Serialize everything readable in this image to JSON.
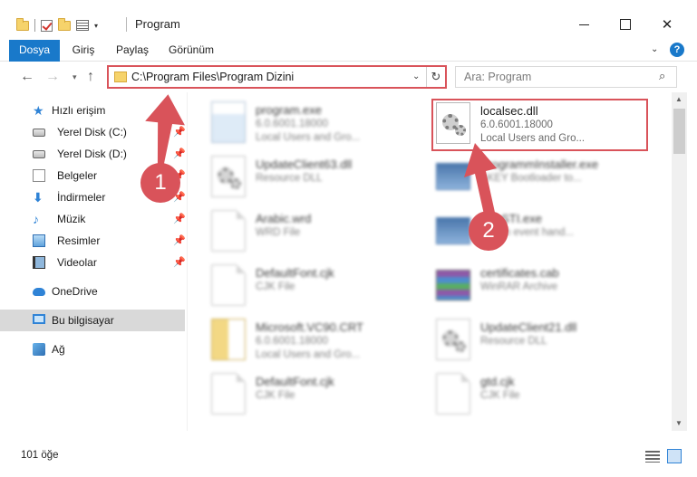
{
  "window": {
    "title": "Program"
  },
  "ribbon": {
    "tabs": [
      "Dosya",
      "Giriş",
      "Paylaş",
      "Görünüm"
    ],
    "help": "?"
  },
  "address": {
    "path": "C:\\Program Files\\Program Dizini"
  },
  "search": {
    "placeholder": "Ara: Program"
  },
  "sidebar": {
    "items": [
      {
        "label": "Hızlı erişim",
        "icon": "star-icon"
      },
      {
        "label": "Yerel Disk (C:)",
        "icon": "drive-icon",
        "pinned": true
      },
      {
        "label": "Yerel Disk (D:)",
        "icon": "drive-icon",
        "pinned": true
      },
      {
        "label": "Belgeler",
        "icon": "documents-icon",
        "pinned": true
      },
      {
        "label": "İndirmeler",
        "icon": "downloads-icon",
        "pinned": true
      },
      {
        "label": "Müzik",
        "icon": "music-icon",
        "pinned": true
      },
      {
        "label": "Resimler",
        "icon": "pictures-icon",
        "pinned": true
      },
      {
        "label": "Videolar",
        "icon": "videos-icon",
        "pinned": true
      },
      {
        "label": "OneDrive",
        "icon": "cloud-icon"
      },
      {
        "label": "Bu bilgisayar",
        "icon": "computer-icon",
        "selected": true
      },
      {
        "label": "Ağ",
        "icon": "network-icon"
      }
    ]
  },
  "files": [
    {
      "name": "program.exe",
      "line2": "6.0.6001.18000",
      "line3": "Local Users and Gro...",
      "blurred": true
    },
    {
      "name": "localsec.dll",
      "line2": "6.0.6001.18000",
      "line3": "Local Users and Gro...",
      "blurred": false,
      "highlighted": true
    },
    {
      "name": "UpdateClient63.dll",
      "line2": "Resource DLL",
      "line3": "",
      "blurred": true
    },
    {
      "name": "ProgrammInstaller.exe",
      "line2": "AKEY Bootloader to...",
      "line3": "",
      "blurred": true
    },
    {
      "name": "Arabic.wrd",
      "line2": "WRD File",
      "line3": "",
      "blurred": true
    },
    {
      "name": "AppSTI.exe",
      "line2": "STI ch event hand...",
      "line3": "",
      "blurred": true
    },
    {
      "name": "DefaultFont.cjk",
      "line2": "CJK File",
      "line3": "",
      "blurred": true
    },
    {
      "name": "certificates.cab",
      "line2": "WinRAR Archive",
      "line3": "",
      "blurred": true
    },
    {
      "name": "Microsoft.VC90.CRT",
      "line2": "6.0.6001.18000",
      "line3": "Local Users and Gro...",
      "blurred": true
    },
    {
      "name": "UpdateClient21.dll",
      "line2": "Resource DLL",
      "line3": "",
      "blurred": true
    },
    {
      "name": "DefaultFont.cjk",
      "line2": "CJK File",
      "line3": "",
      "blurred": true
    },
    {
      "name": "gtd.cjk",
      "line2": "CJK File",
      "line3": "",
      "blurred": true
    }
  ],
  "status": {
    "count": "101 öğe"
  },
  "annotations": {
    "step1": "1",
    "step2": "2",
    "color": "#d9535a"
  }
}
